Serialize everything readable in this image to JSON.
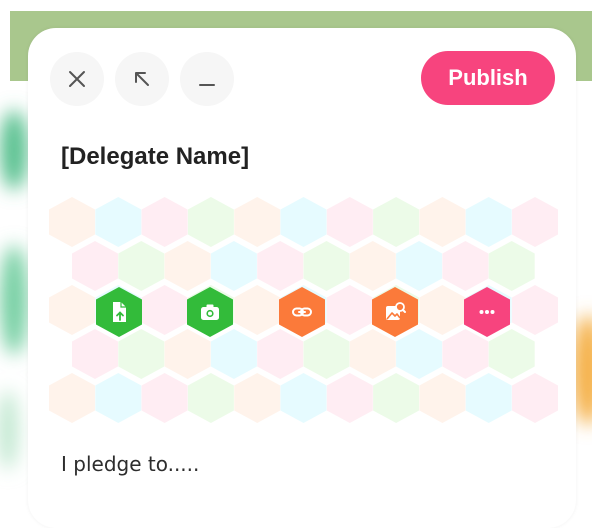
{
  "window": {
    "close_icon": "close-icon",
    "expand_icon": "arrow-up-left-icon",
    "minimize_icon": "minimize-icon"
  },
  "header": {
    "publish_label": "Publish"
  },
  "card": {
    "title": "[Delegate Name]",
    "pledge_text": "I pledge to....."
  },
  "toolbar": [
    {
      "name": "file-upload-icon",
      "color": "#33bb3a"
    },
    {
      "name": "camera-icon",
      "color": "#33bb3a"
    },
    {
      "name": "link-icon",
      "color": "#fb7a3a"
    },
    {
      "name": "image-search-icon",
      "color": "#fb7a3a"
    },
    {
      "name": "more-icon",
      "color": "#f7447e"
    }
  ],
  "colors": {
    "accent": "#f7447e",
    "green_tool": "#33bb3a",
    "orange_tool": "#fb7a3a",
    "hex_palette": [
      "#fff3eb",
      "#e6fbff",
      "#ffedf3",
      "#ecfbe8"
    ]
  }
}
